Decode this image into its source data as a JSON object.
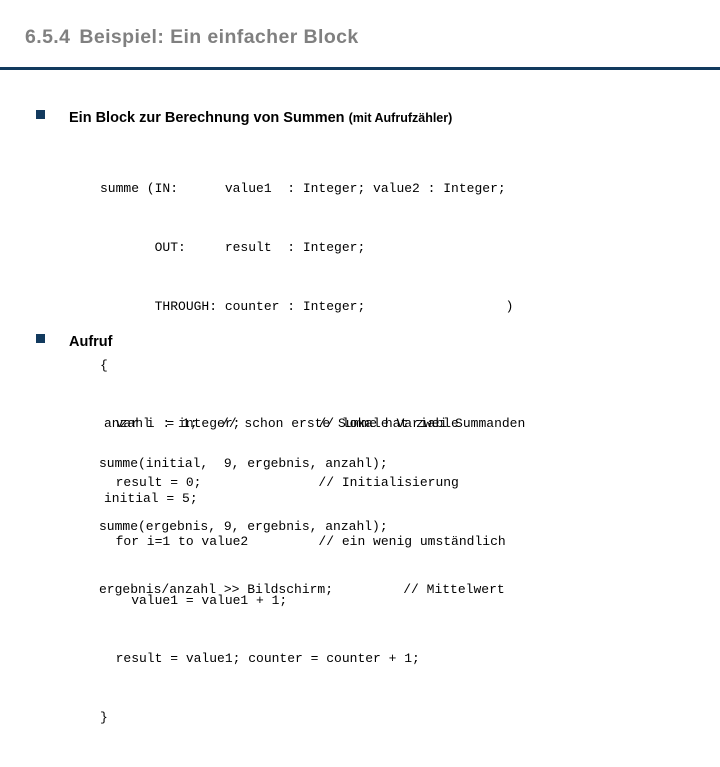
{
  "slide": {
    "title_number": "6.5.4",
    "title_text": "Beispiel: Ein einfacher Block",
    "rule_color": "#123a5e",
    "title_color": "#808080",
    "bullet_color": "#123a5e"
  },
  "bullets": [
    {
      "marker": "square-bullet",
      "text_main": "Ein Block zur Berechnung von Summen ",
      "text_sub": "(mit Aufrufzähler)"
    },
    {
      "marker": "square-bullet",
      "text_main": "Aufruf",
      "text_sub": ""
    }
  ],
  "code_blocks": [
    {
      "name": "block-definition",
      "lines": [
        "summe (IN:      value1  : Integer; value2 : Integer;",
        "       OUT:     result  : Integer;",
        "       THROUGH: counter : Integer;                  )",
        "{",
        "  var i : integer;          // lokale Variable",
        "  result = 0;               // Initialisierung",
        "  for i=1 to value2         // ein wenig umständlich",
        "    value1 = value1 + 1;",
        "  result = value1; counter = counter + 1;",
        "}"
      ]
    },
    {
      "name": "call-variables",
      "lines": [
        "anzahl  = 1;   // schon erste Summe hat zwei Summanden",
        "initial = 5;"
      ]
    },
    {
      "name": "call-statements",
      "lines": [
        "summe(initial,  9, ergebnis, anzahl);",
        "summe(ergebnis, 9, ergebnis, anzahl);",
        "ergebnis/anzahl >> Bildschirm;         // Mittelwert"
      ]
    }
  ]
}
